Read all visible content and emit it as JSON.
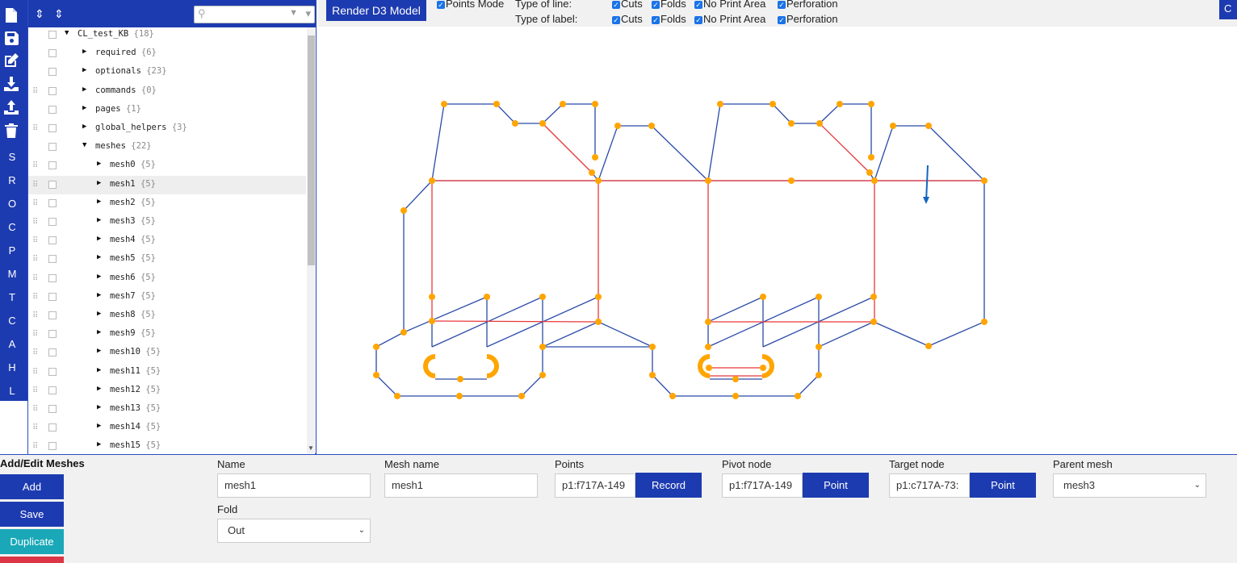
{
  "tree": {
    "search": {
      "placeholder": ""
    },
    "rows": [
      {
        "label": "CL_test_KB",
        "count": "{18}",
        "depth": 0,
        "expanded": true,
        "drag": false,
        "selected": false
      },
      {
        "label": "required",
        "count": "{6}",
        "depth": 1,
        "expanded": false,
        "drag": false,
        "selected": false
      },
      {
        "label": "optionals",
        "count": "{23}",
        "depth": 1,
        "expanded": false,
        "drag": false,
        "selected": false
      },
      {
        "label": "commands",
        "count": "{0}",
        "depth": 1,
        "expanded": false,
        "drag": true,
        "selected": false
      },
      {
        "label": "pages",
        "count": "{1}",
        "depth": 1,
        "expanded": false,
        "drag": false,
        "selected": false
      },
      {
        "label": "global_helpers",
        "count": "{3}",
        "depth": 1,
        "expanded": false,
        "drag": true,
        "selected": false
      },
      {
        "label": "meshes",
        "count": "{22}",
        "depth": 1,
        "expanded": true,
        "drag": false,
        "selected": false
      },
      {
        "label": "mesh0",
        "count": "{5}",
        "depth": 2,
        "expanded": false,
        "drag": true,
        "selected": false
      },
      {
        "label": "mesh1",
        "count": "{5}",
        "depth": 2,
        "expanded": false,
        "drag": true,
        "selected": true
      },
      {
        "label": "mesh2",
        "count": "{5}",
        "depth": 2,
        "expanded": false,
        "drag": true,
        "selected": false
      },
      {
        "label": "mesh3",
        "count": "{5}",
        "depth": 2,
        "expanded": false,
        "drag": true,
        "selected": false
      },
      {
        "label": "mesh4",
        "count": "{5}",
        "depth": 2,
        "expanded": false,
        "drag": true,
        "selected": false
      },
      {
        "label": "mesh5",
        "count": "{5}",
        "depth": 2,
        "expanded": false,
        "drag": true,
        "selected": false
      },
      {
        "label": "mesh6",
        "count": "{5}",
        "depth": 2,
        "expanded": false,
        "drag": true,
        "selected": false
      },
      {
        "label": "mesh7",
        "count": "{5}",
        "depth": 2,
        "expanded": false,
        "drag": true,
        "selected": false
      },
      {
        "label": "mesh8",
        "count": "{5}",
        "depth": 2,
        "expanded": false,
        "drag": true,
        "selected": false
      },
      {
        "label": "mesh9",
        "count": "{5}",
        "depth": 2,
        "expanded": false,
        "drag": true,
        "selected": false
      },
      {
        "label": "mesh10",
        "count": "{5}",
        "depth": 2,
        "expanded": false,
        "drag": true,
        "selected": false
      },
      {
        "label": "mesh11",
        "count": "{5}",
        "depth": 2,
        "expanded": false,
        "drag": true,
        "selected": false
      },
      {
        "label": "mesh12",
        "count": "{5}",
        "depth": 2,
        "expanded": false,
        "drag": true,
        "selected": false
      },
      {
        "label": "mesh13",
        "count": "{5}",
        "depth": 2,
        "expanded": false,
        "drag": true,
        "selected": false
      },
      {
        "label": "mesh14",
        "count": "{5}",
        "depth": 2,
        "expanded": false,
        "drag": true,
        "selected": false
      },
      {
        "label": "mesh15",
        "count": "{5}",
        "depth": 2,
        "expanded": false,
        "drag": true,
        "selected": false
      }
    ]
  },
  "sidebar": {
    "icons": [
      "new-file-icon",
      "save-icon",
      "edit-icon",
      "download-icon",
      "upload-icon",
      "trash-icon"
    ],
    "letters": [
      "S",
      "R",
      "O",
      "C",
      "P",
      "M",
      "T",
      "C",
      "A",
      "H",
      "L"
    ]
  },
  "toolbar": {
    "render_label": "Render D3 Model",
    "points_mode_label": "Points Mode",
    "type_of_line_label": "Type of line:",
    "type_of_label_label": "Type of label:",
    "line_options": [
      "Cuts",
      "Folds",
      "No Print Area",
      "Perforation"
    ],
    "label_options": [
      "Cuts",
      "Folds",
      "No Print Area",
      "Perforation"
    ],
    "corner_label": "C"
  },
  "form": {
    "title": "Add/Edit Meshes",
    "add_label": "Add",
    "save_label": "Save",
    "duplicate_label": "Duplicate",
    "name_label": "Name",
    "name_value": "mesh1",
    "mesh_name_label": "Mesh name",
    "mesh_name_value": "mesh1",
    "points_label": "Points",
    "points_value": "p1:f717A-149",
    "record_label": "Record",
    "pivot_label": "Pivot node",
    "pivot_value": "p1:f717A-149",
    "pivot_point_label": "Point",
    "target_label": "Target node",
    "target_value": "p1:c717A-73:",
    "target_point_label": "Point",
    "parent_label": "Parent mesh",
    "parent_value": "mesh3",
    "fold_label": "Fold",
    "fold_value": "Out"
  },
  "colors": {
    "primary": "#1d3bb0",
    "cut_line": "#2a4aa8",
    "fold_line": "#e8383b",
    "point": "#ffa500",
    "duplicate": "#1aa8b8",
    "danger": "#dc3545"
  }
}
